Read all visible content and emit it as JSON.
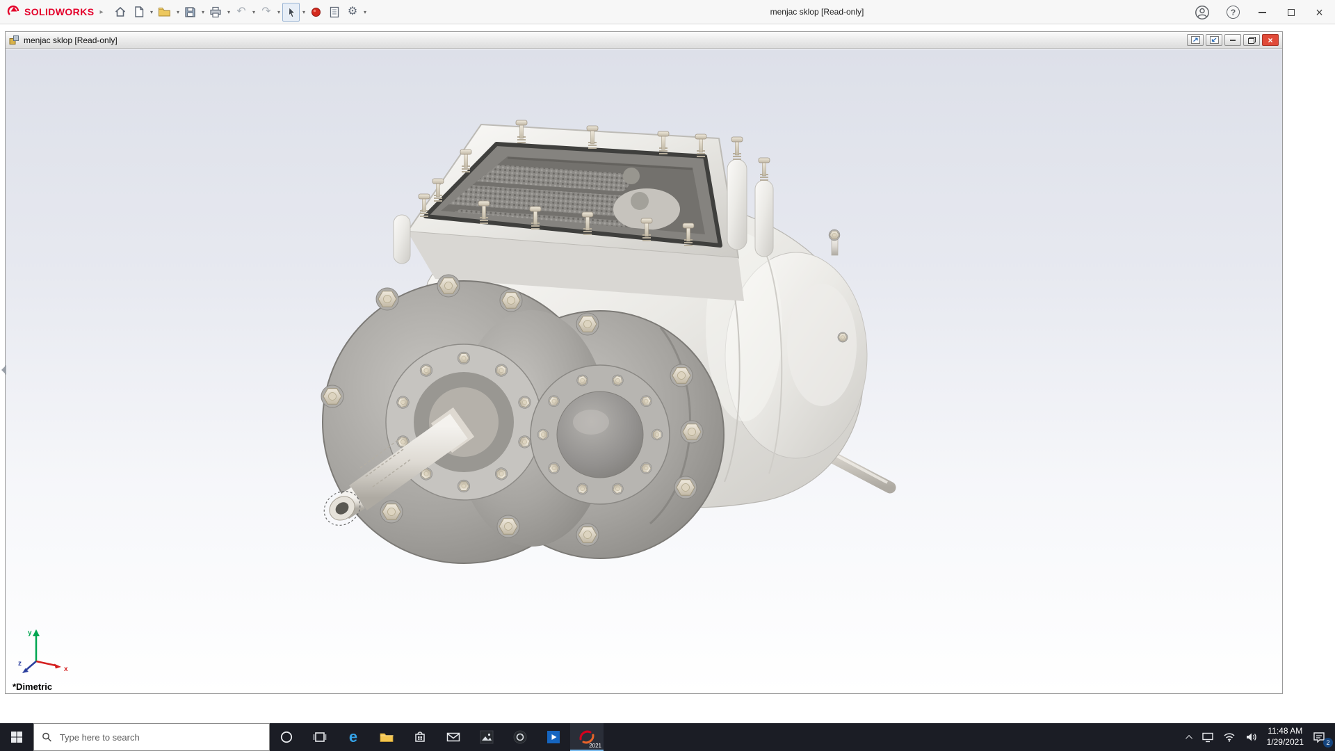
{
  "app": {
    "brand": "SOLIDWORKS",
    "window_title": "menjac sklop [Read-only]"
  },
  "document": {
    "title": "menjac sklop [Read-only]"
  },
  "viewport": {
    "view_label": "*Dimetric",
    "axes": {
      "x": "x",
      "y": "y",
      "z": "z"
    }
  },
  "taskbar": {
    "search_placeholder": "Type here to search",
    "solidworks_year": "2021",
    "time": "11:48 AM",
    "date": "1/29/2021",
    "notification_badge": "2"
  },
  "icons": {
    "breadcrumb_arrow": "▸",
    "dropdown_caret": "▾",
    "undo": "↶",
    "redo": "↷",
    "options_gear": "⚙",
    "help": "?",
    "close": "×",
    "edge_letter": "e"
  },
  "colors": {
    "brand_red": "#e4002b",
    "titlebar_bg": "#f7f7f7",
    "viewport_gradient_top": "#dde0e9",
    "viewport_gradient_bottom": "#ffffff",
    "taskbar_bg": "#1b1d25",
    "active_tool_highlight": "#e7eef7",
    "doc_close_button_red": "#e04a38",
    "notification_badge_blue": "#14447e",
    "triad_x_red": "#d42020",
    "triad_y_green": "#00a651",
    "triad_z_blue": "#2b3f9e"
  }
}
